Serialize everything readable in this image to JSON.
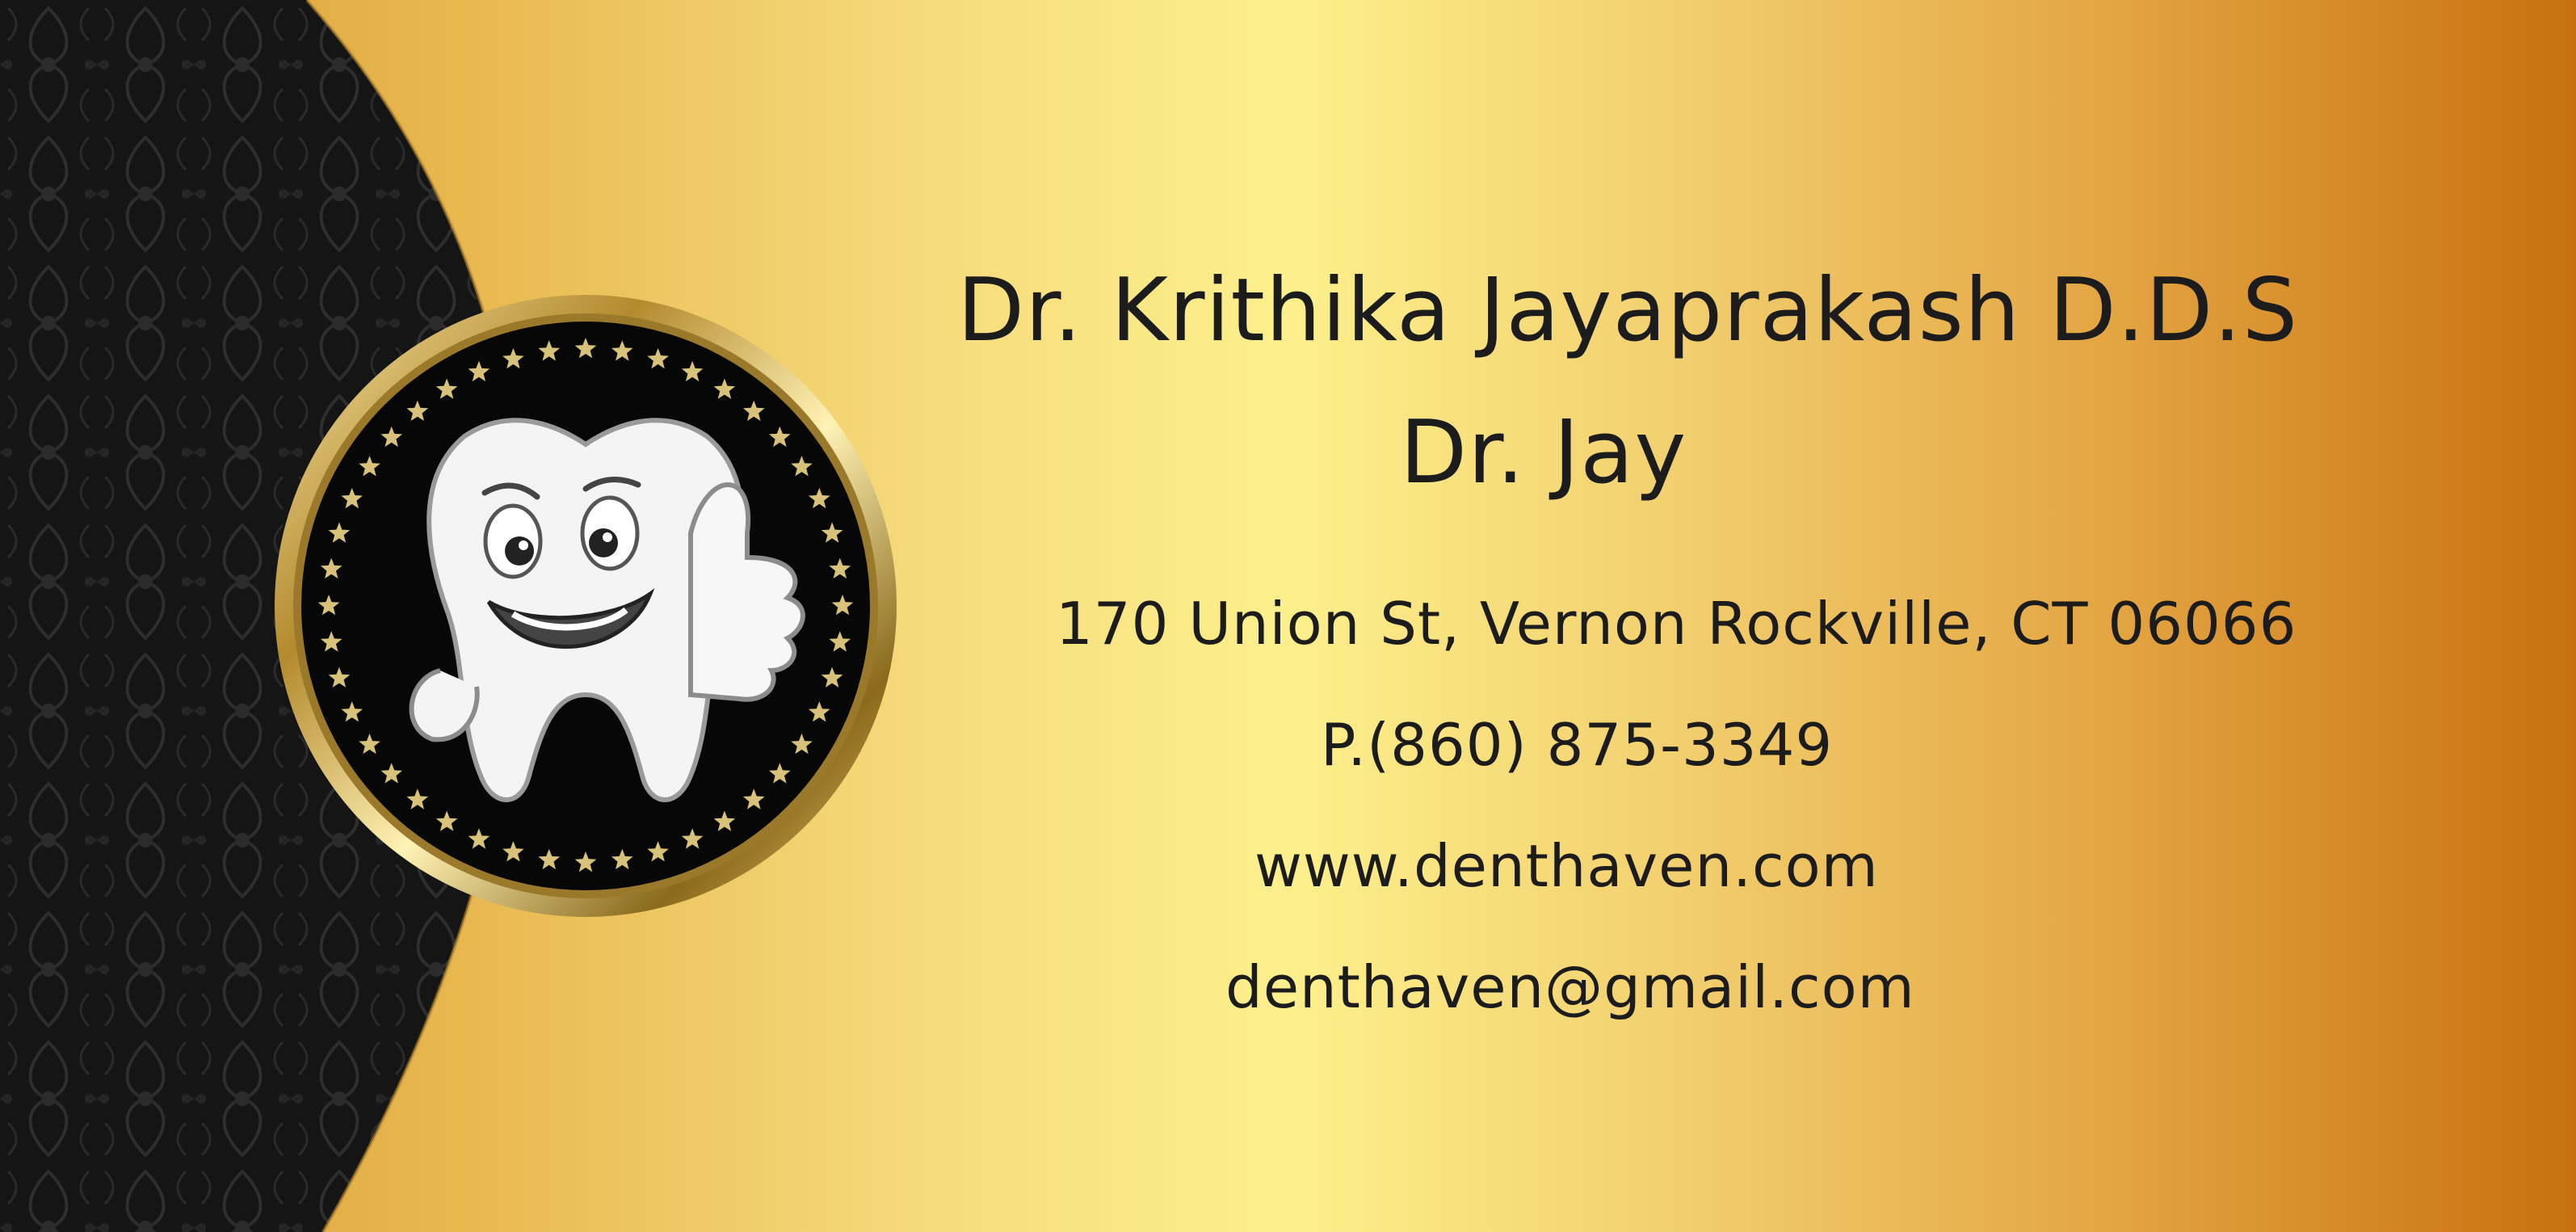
{
  "card": {
    "doctor_name": "Dr. Krithika Jayaprakash D.D.S",
    "nickname": "Dr. Jay",
    "address": "170 Union St, Vernon Rockville, CT 06066",
    "phone": "P.(860) 875-3349",
    "website": "www.denthaven.com",
    "email": "denthaven@gmail.com"
  },
  "logo": {
    "icon": "smiling-tooth-thumbs-up-icon"
  },
  "colors": {
    "gold_light": "#fdf08c",
    "gold_mid": "#e8b84f",
    "gold_dark": "#c8700f",
    "panel_black": "#1a1a1a",
    "text": "#1c1c1c"
  }
}
